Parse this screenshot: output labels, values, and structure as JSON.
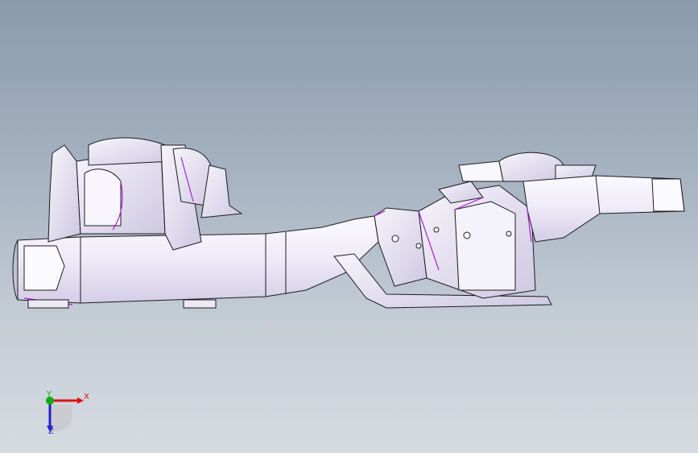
{
  "viewport": {
    "background_top": "#8a9aad",
    "background_bottom": "#d6dbe1"
  },
  "model": {
    "part_fill": "#f3f1f9",
    "part_shade": "#d9d3ea",
    "edge_color": "#1b1b22",
    "feature_edge_color": "#b01fd0"
  },
  "triad": {
    "x_label": "X",
    "y_label": "Y",
    "z_label": "Z",
    "x_color": "#dd1111",
    "y_color": "#11aa11",
    "z_color": "#2222cc"
  }
}
